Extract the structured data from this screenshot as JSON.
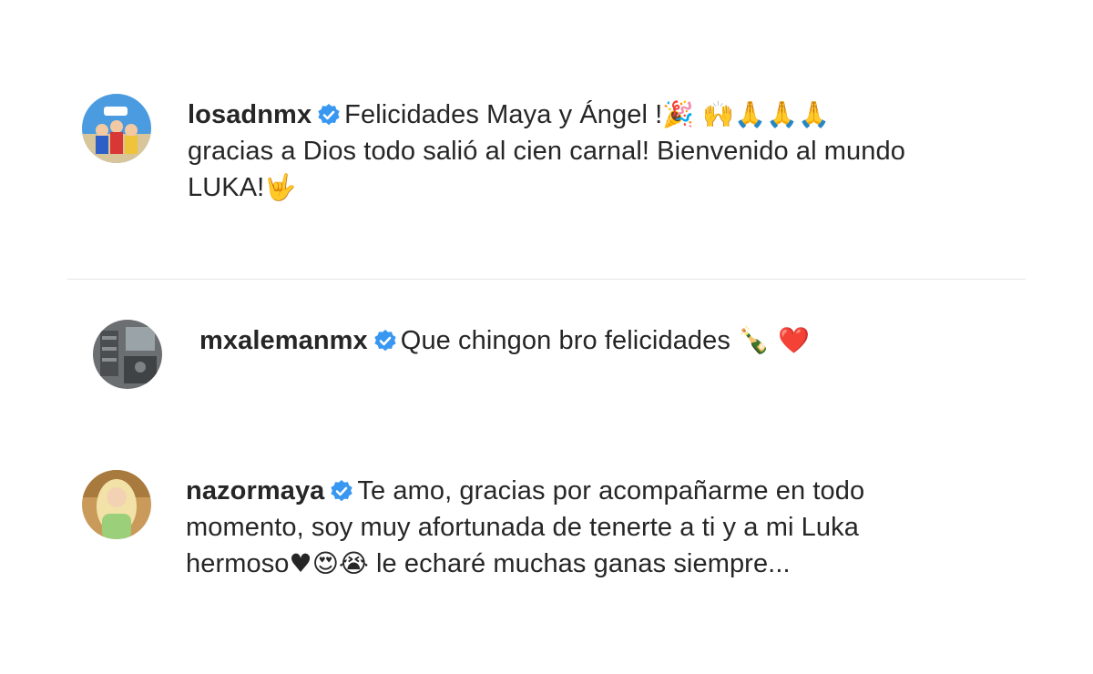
{
  "comments": [
    {
      "username": "losadnmx",
      "verified": true,
      "avatar_icon": "tv-show-cast-avatar",
      "line1": "Felicidades Maya y Ángel !",
      "emoji1": "🎉 🙌🙏🙏🙏",
      "line2": "gracias a Dios todo salió al cien carnal! Bienvenido al mundo",
      "line3": "LUKA!",
      "emoji3": "🤟"
    },
    {
      "username": "mxalemanmx",
      "verified": true,
      "avatar_icon": "room-avatar",
      "line1": "Que chingon bro felicidades ",
      "emoji1": "🍾 ❤️"
    },
    {
      "username": "nazormaya",
      "verified": true,
      "avatar_icon": "woman-avatar",
      "line1": "Te amo, gracias por acompañarme en todo",
      "line2": "momento, soy muy afortunada de tenerte a ti y a mi Luka",
      "line3a": "hermoso",
      "emoji3": "♥😍😭",
      "line3b": " le echaré muchas ganas siempre..."
    }
  ],
  "colors": {
    "text": "#262626",
    "verified_badge": "#3897f0",
    "divider": "#e6e6e6"
  }
}
